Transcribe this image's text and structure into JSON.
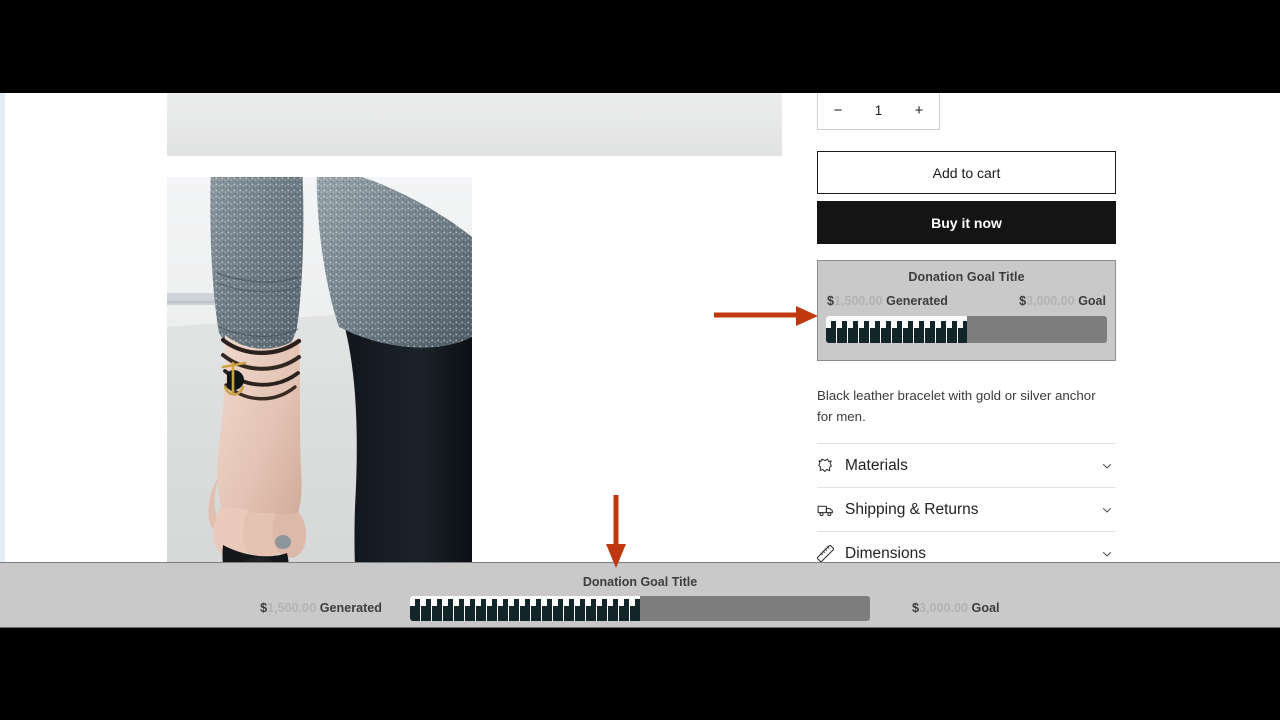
{
  "product": {
    "quantity": {
      "decrease_label": "−",
      "value": "1",
      "increase_label": "+"
    },
    "add_to_cart_label": "Add to cart",
    "buy_it_now_label": "Buy it now",
    "description": "Black leather bracelet with gold or silver anchor for men.",
    "accordions": [
      {
        "label": "Materials",
        "icon": "leather-hide-icon",
        "chevron": "chevron-down-icon"
      },
      {
        "label": "Shipping & Returns",
        "icon": "truck-icon",
        "chevron": "chevron-down-icon"
      },
      {
        "label": "Dimensions",
        "icon": "ruler-icon",
        "chevron": "chevron-down-icon"
      }
    ]
  },
  "donation_widget": {
    "title": "Donation Goal Title",
    "generated_currency": "$",
    "generated_amount": "1,500.00",
    "generated_label": "Generated",
    "goal_currency": "$",
    "goal_amount": "3,000.00",
    "goal_label": "Goal",
    "progress_percent": 50,
    "colors": {
      "background": "#c9c9c9",
      "border": "#8c8c8c",
      "track": "#7d7d7d",
      "bar": "#12262a",
      "fill_background": "#fbfbfb",
      "amount_text": "#b3b3b3",
      "label_text": "#3d3d3d"
    }
  },
  "sticky_bar": {
    "title": "Donation Goal Title",
    "generated_currency": "$",
    "generated_amount": "1,500.00",
    "generated_label": "Generated",
    "goal_currency": "$",
    "goal_amount": "3,000.00",
    "goal_label": "Goal",
    "progress_percent": 50
  },
  "annotations": {
    "color": "#c0380f",
    "arrows": [
      {
        "name": "arrow-to-donation-widget",
        "direction": "right"
      },
      {
        "name": "arrow-to-sticky-bar",
        "direction": "down"
      }
    ]
  },
  "media": {
    "placeholder_name": "product-image-placeholder",
    "photo_name": "product-photo-bracelet"
  }
}
